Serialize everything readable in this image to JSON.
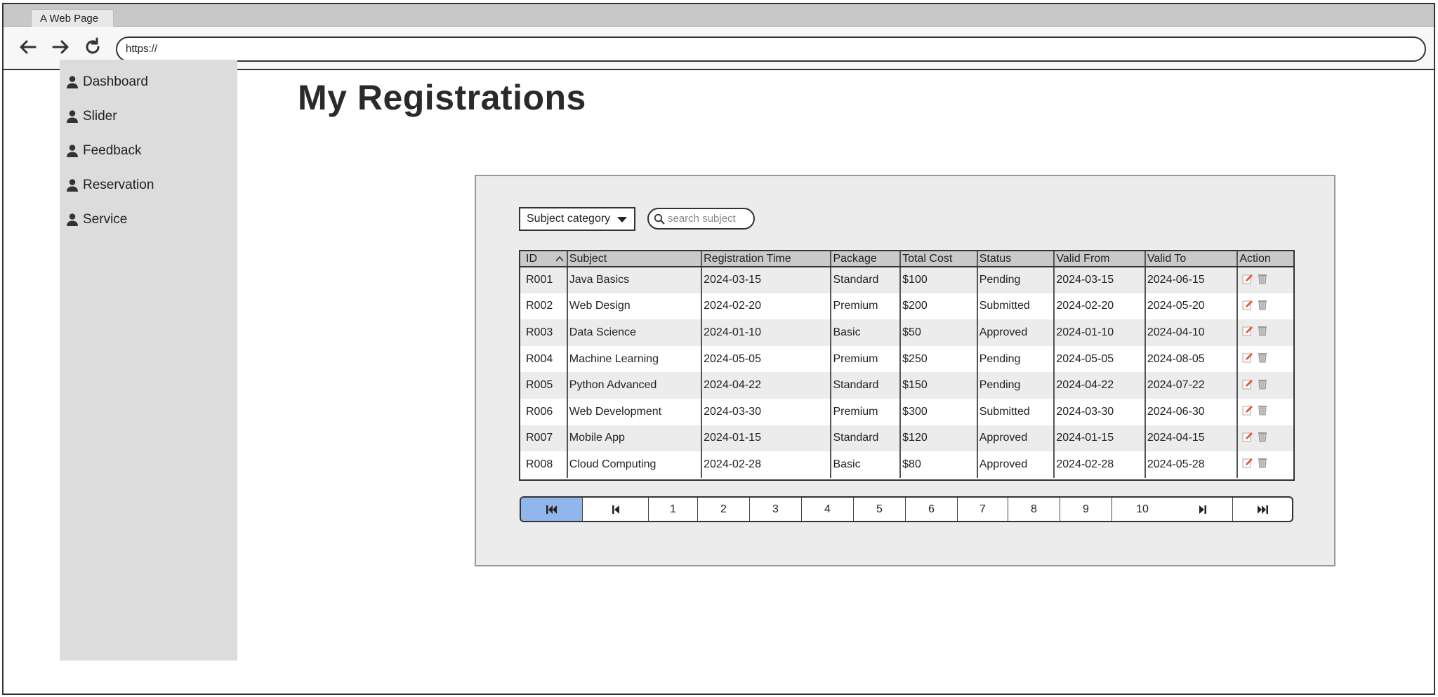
{
  "browser": {
    "tab_title": "A Web Page",
    "url": "https://"
  },
  "sidebar": {
    "items": [
      {
        "label": "Dashboard",
        "icon": "user-icon"
      },
      {
        "label": "Slider",
        "icon": "user-icon"
      },
      {
        "label": "Feedback",
        "icon": "user-icon"
      },
      {
        "label": "Reservation",
        "icon": "user-icon"
      },
      {
        "label": "Service",
        "icon": "user-icon"
      }
    ]
  },
  "page": {
    "title": "My Registrations"
  },
  "filters": {
    "category_label": "Subject category",
    "search_placeholder": "search subject"
  },
  "table": {
    "headers": [
      "ID",
      "Subject",
      "Registration Time",
      "Package",
      "Total Cost",
      "Status",
      "Valid From",
      "Valid To",
      "Action"
    ],
    "rows": [
      [
        "R001",
        "Java Basics",
        "2024-03-15",
        "Standard",
        "$100",
        "Pending",
        "2024-03-15",
        "2024-06-15"
      ],
      [
        "R002",
        "Web Design",
        "2024-02-20",
        "Premium",
        "$200",
        "Submitted",
        "2024-02-20",
        "2024-05-20"
      ],
      [
        "R003",
        "Data Science",
        "2024-01-10",
        "Basic",
        "$50",
        "Approved",
        "2024-01-10",
        "2024-04-10"
      ],
      [
        "R004",
        "Machine Learning",
        "2024-05-05",
        "Premium",
        "$250",
        "Pending",
        "2024-05-05",
        "2024-08-05"
      ],
      [
        "R005",
        "Python Advanced",
        "2024-04-22",
        "Standard",
        "$150",
        "Pending",
        "2024-04-22",
        "2024-07-22"
      ],
      [
        "R006",
        "Web Development",
        "2024-03-30",
        "Premium",
        "$300",
        "Submitted",
        "2024-03-30",
        "2024-06-30"
      ],
      [
        "R007",
        "Mobile App",
        "2024-01-15",
        "Standard",
        "$120",
        "Approved",
        "2024-01-15",
        "2024-04-15"
      ],
      [
        "R008",
        "Cloud Computing",
        "2024-02-28",
        "Basic",
        "$80",
        "Approved",
        "2024-02-28",
        "2024-05-28"
      ]
    ],
    "action_icons": [
      "edit-icon",
      "trash-icon"
    ]
  },
  "pagination": {
    "pages": [
      "1",
      "2",
      "3",
      "4",
      "5",
      "6",
      "7",
      "8",
      "9",
      "10"
    ],
    "first_icon": "first-page-icon",
    "prev_icon": "previous-page-icon",
    "next_icon": "next-page-icon",
    "last_icon": "last-page-icon",
    "active": "first"
  },
  "colors": {
    "sidebar_bg": "#dcdcdc",
    "panel_bg": "#ececec",
    "header_bg": "#c9c9c9",
    "pager_active": "#90b6ec",
    "edit_accent": "#e8572a"
  }
}
